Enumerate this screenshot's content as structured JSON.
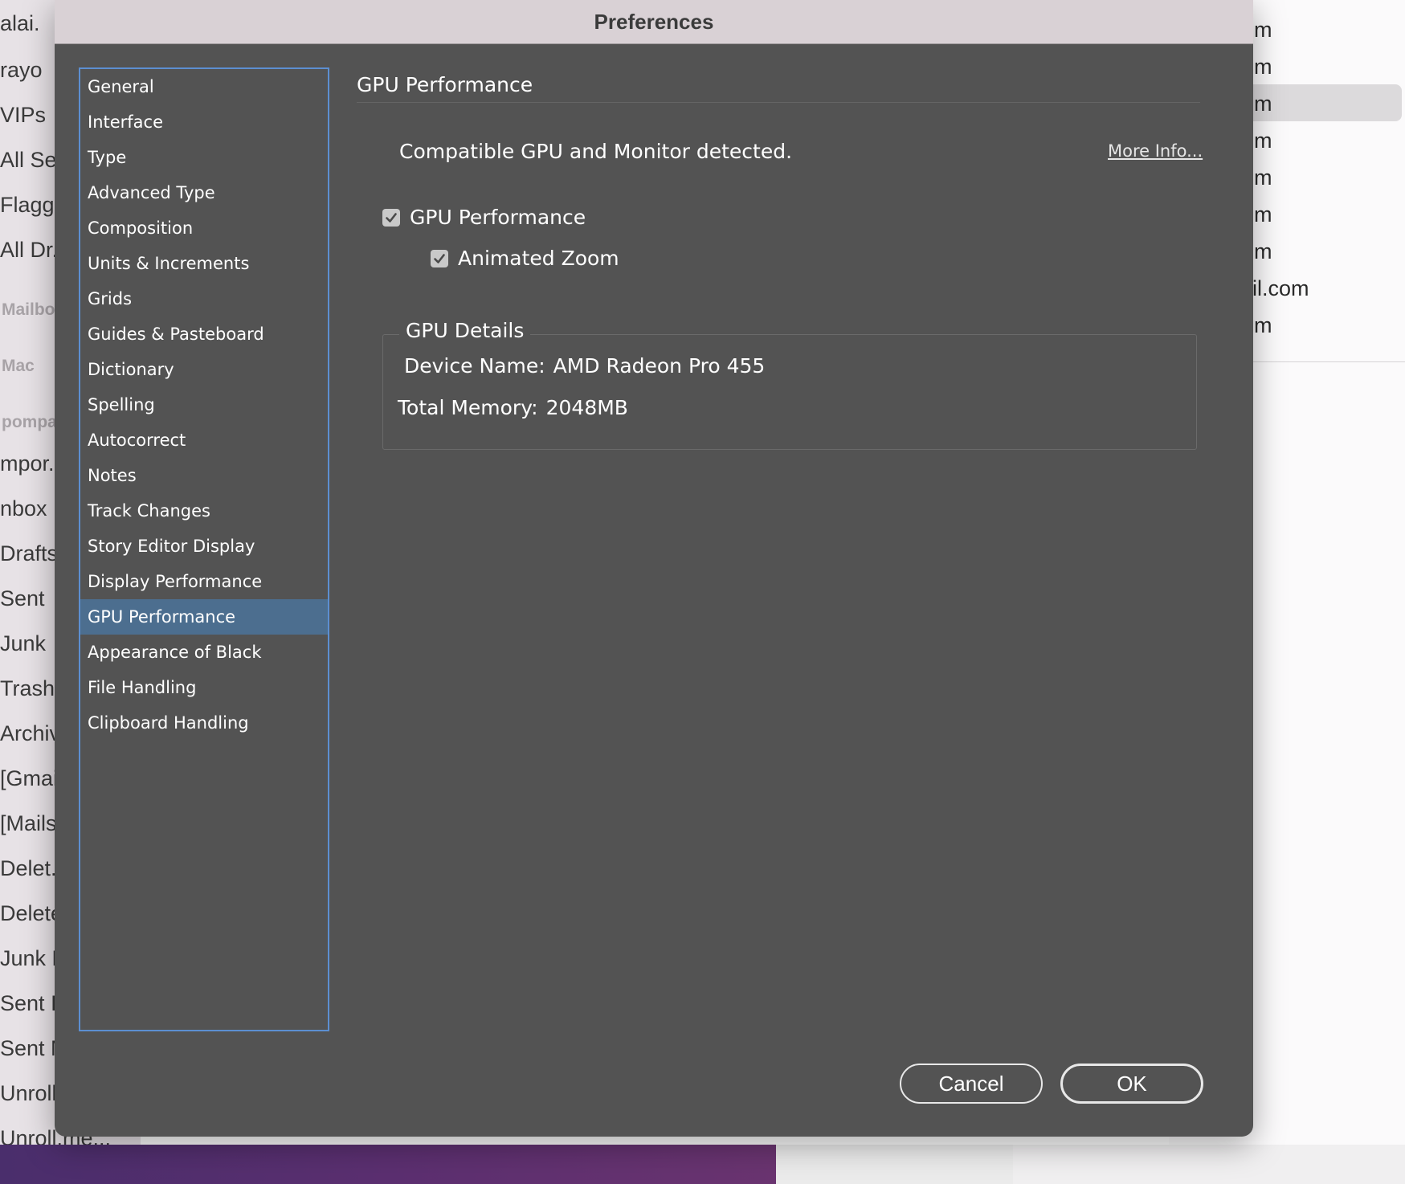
{
  "background": {
    "mail_sidebar_items": [
      "alai.",
      "rayo",
      "VIPs",
      "All Ser",
      "Flagg..",
      "All Dr..",
      "mpor..",
      "nbox",
      "Drafts",
      "Sent",
      "Junk",
      "Trash",
      "Archiv",
      "[Gmail",
      "[Mailst",
      "Delet..",
      "Delete",
      "Junk E",
      "Sent It",
      "Sent M",
      "Unroll.",
      "Unroll.me..."
    ],
    "mail_sections": [
      "Mailbo",
      "Mac",
      "pompa"
    ],
    "message_list_fragments": [
      "m",
      "m",
      "m",
      "m",
      "m",
      "m",
      "m",
      "il.com",
      "m"
    ]
  },
  "dialog": {
    "title": "Preferences",
    "nav_items": [
      {
        "label": "General"
      },
      {
        "label": "Interface"
      },
      {
        "label": "Type"
      },
      {
        "label": "Advanced Type"
      },
      {
        "label": "Composition"
      },
      {
        "label": "Units & Increments"
      },
      {
        "label": "Grids"
      },
      {
        "label": "Guides & Pasteboard"
      },
      {
        "label": "Dictionary"
      },
      {
        "label": "Spelling"
      },
      {
        "label": "Autocorrect"
      },
      {
        "label": "Notes"
      },
      {
        "label": "Track Changes"
      },
      {
        "label": "Story Editor Display"
      },
      {
        "label": "Display Performance"
      },
      {
        "label": "GPU Performance",
        "selected": true
      },
      {
        "label": "Appearance of Black"
      },
      {
        "label": "File Handling"
      },
      {
        "label": "Clipboard Handling"
      }
    ],
    "panel": {
      "heading": "GPU Performance",
      "status_text": "Compatible GPU and Monitor detected.",
      "more_info_label": "More Info...",
      "gpu_performance": {
        "label": "GPU Performance",
        "checked": true
      },
      "animated_zoom": {
        "label": "Animated Zoom",
        "checked": true
      },
      "gpu_details": {
        "legend": "GPU Details",
        "device_name_label": "Device Name:",
        "device_name_value": "AMD Radeon Pro 455",
        "total_memory_label": "Total Memory:",
        "total_memory_value": "2048MB"
      }
    },
    "buttons": {
      "cancel": "Cancel",
      "ok": "OK"
    }
  },
  "colors": {
    "dialog_bg": "#535353",
    "selected_item_bg": "#4c6e8f",
    "sidebar_focus_border": "#5c8fd1"
  }
}
